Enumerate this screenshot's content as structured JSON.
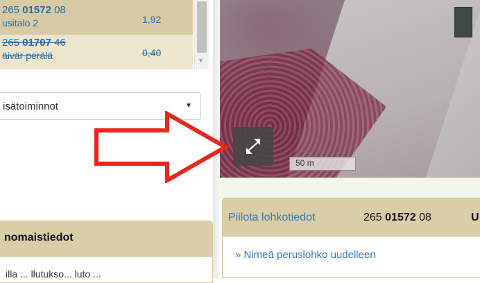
{
  "parcels": [
    {
      "num_prefix": "265 ",
      "num_bold": "01572",
      "num_suffix": " 08",
      "name": "usitalo 2",
      "area": "1,92",
      "struck": false
    },
    {
      "num_prefix": "265 ",
      "num_bold": "01707",
      "num_suffix": " 46",
      "name": "äivär perälä",
      "area": "0,40",
      "struck": true
    }
  ],
  "actions_select": {
    "selected": "isätoiminnot"
  },
  "authority_panel": {
    "title": "nomaistiedot",
    "clipped_text": "illa ... llutukso... luto ..."
  },
  "map": {
    "scale_label": "50 m"
  },
  "info_panel": {
    "hide_link": "Piilota lohkotiedot",
    "parcel_prefix": "265 ",
    "parcel_bold": "01572",
    "parcel_suffix": " 08",
    "trailing": "U",
    "rename_link": "» Nimeä peruslohko uudelleen"
  },
  "colors": {
    "accent_link": "#3a77b3",
    "panel_header": "#d9cea7",
    "annotation_arrow": "#e8261c"
  }
}
